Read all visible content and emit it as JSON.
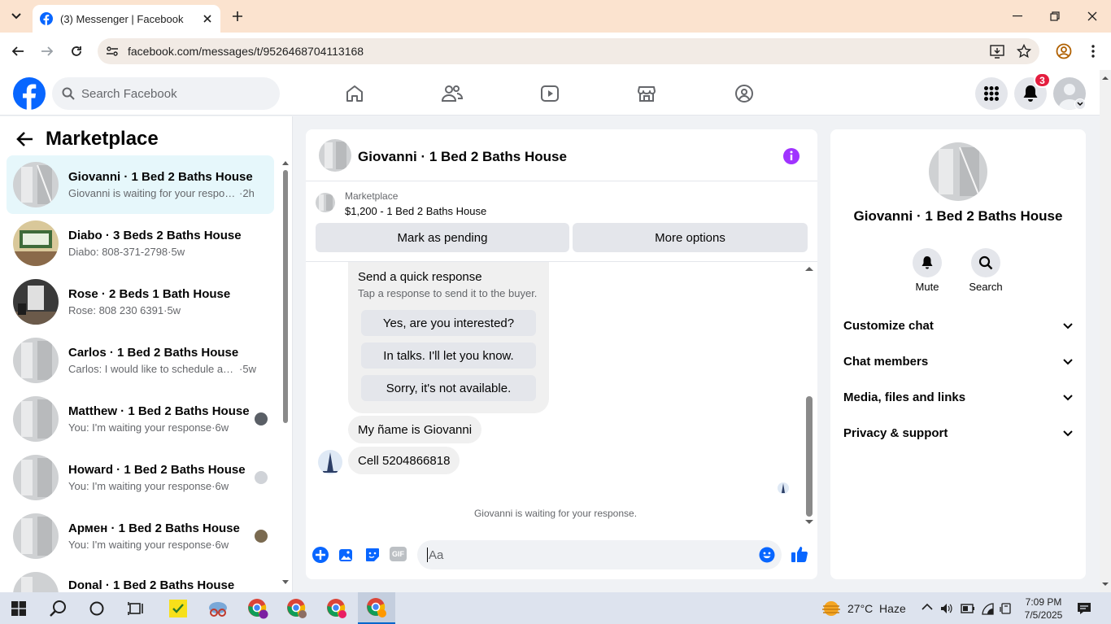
{
  "browser": {
    "tab_title": "(3) Messenger | Facebook",
    "url": "facebook.com/messages/t/9526468704113168"
  },
  "header": {
    "search_placeholder": "Search Facebook",
    "notification_count": "3"
  },
  "left": {
    "title": "Marketplace",
    "conversations": [
      {
        "name": "Giovanni · 1 Bed 2 Baths House",
        "message": "Giovanni is waiting for your respon...",
        "time": "2h"
      },
      {
        "name": "Diabo · 3 Beds 2 Baths House",
        "message": "Diabo: 808-371-2798",
        "time": "5w"
      },
      {
        "name": "Rose · 2 Beds 1 Bath House",
        "message": "Rose: 808 230 6391",
        "time": "5w"
      },
      {
        "name": "Carlos · 1 Bed 2 Baths House",
        "message": "Carlos: I would like to schedule an ...",
        "time": "5w"
      },
      {
        "name": "Matthew · 1 Bed 2 Baths House",
        "message": "You: I'm waiting your response",
        "time": "6w"
      },
      {
        "name": "Howard · 1 Bed 2 Baths House",
        "message": "You: I'm waiting your response",
        "time": "6w"
      },
      {
        "name": "Армен · 1 Bed 2 Baths House",
        "message": "You: I'm waiting your response",
        "time": "6w"
      },
      {
        "name": "Donal · 1 Bed 2 Baths House",
        "message": "",
        "time": ""
      }
    ]
  },
  "chat": {
    "title": "Giovanni · 1 Bed 2 Baths House",
    "listing_source": "Marketplace",
    "listing_title": "$1,200 - 1 Bed 2 Baths House",
    "mark_pending": "Mark as pending",
    "more_options": "More options",
    "quick_title": "Send a quick response",
    "quick_sub": "Tap a response to send it to the buyer.",
    "quick_responses": [
      "Yes, are you interested?",
      "In talks. I'll let you know.",
      "Sorry, it's not available."
    ],
    "messages": [
      "My ñame is Giovanni",
      "Cell 5204866818"
    ],
    "waiting": "Giovanni is waiting for your response.",
    "composer_placeholder": "Aa"
  },
  "right": {
    "title": "Giovanni · 1 Bed 2 Baths House",
    "mute": "Mute",
    "search": "Search",
    "sections": [
      "Customize chat",
      "Chat members",
      "Media, files and links",
      "Privacy & support"
    ]
  },
  "taskbar": {
    "weather": "27°C  Haze",
    "time": "7:09 PM",
    "date": "7/5/2025"
  },
  "colors": {
    "facebook_blue": "#0866ff",
    "messenger_purple": "#a033ff",
    "active_conversation": "#e6f7fb",
    "tab_strip": "#fbe3cf",
    "notification_red": "#e41e3f"
  }
}
